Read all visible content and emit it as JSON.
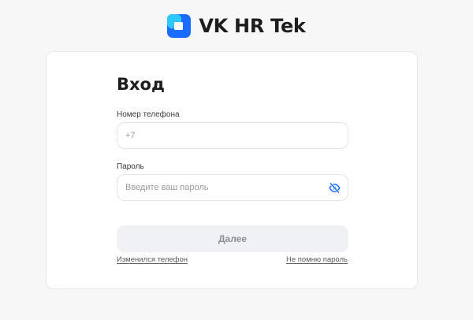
{
  "brand": {
    "name": "VK HR Tek"
  },
  "login": {
    "title": "Вход",
    "phone": {
      "label": "Номер телефона",
      "placeholder": "+7",
      "value": ""
    },
    "password": {
      "label": "Пароль",
      "placeholder": "Введите ваш пароль",
      "value": "",
      "toggle_icon": "eye-off-icon"
    },
    "submit_label": "Далее",
    "links": {
      "phone_changed": "Изменился телефон",
      "forgot_password": "Не помню пароль"
    }
  },
  "colors": {
    "accent": "#1a6cff",
    "logo_light": "#2ec7ff",
    "button_bg": "#f0f1f4",
    "button_text": "#8d8e95"
  }
}
